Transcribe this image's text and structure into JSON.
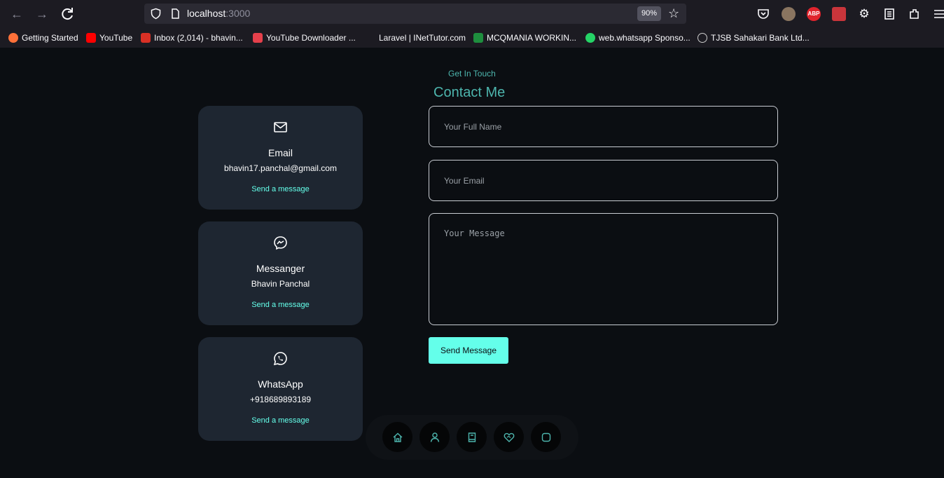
{
  "browser": {
    "url_host": "localhost",
    "url_port": ":3000",
    "zoom": "90%",
    "bookmarks": [
      {
        "label": "Getting Started",
        "color": "#ff7139"
      },
      {
        "label": "YouTube",
        "color": "#ff0000"
      },
      {
        "label": "Inbox (2,014) - bhavin...",
        "color": "#d93025"
      },
      {
        "label": "YouTube Downloader ...",
        "color": "#e5404b"
      },
      {
        "label": "Laravel | INetTutor.com",
        "color": ""
      },
      {
        "label": "MCQMANIA WORKIN...",
        "color": "#1e8e3e"
      },
      {
        "label": "web.whatsapp Sponso...",
        "color": "#25d366"
      },
      {
        "label": "TJSB Sahakari Bank Ltd...",
        "color": "#cccccc"
      }
    ]
  },
  "section": {
    "subtitle": "Get In Touch",
    "title": "Contact Me"
  },
  "contacts": [
    {
      "icon": "mail-icon",
      "title": "Email",
      "value": "bhavin17.panchal@gmail.com",
      "link": "Send a message"
    },
    {
      "icon": "messenger-icon",
      "title": "Messanger",
      "value": "Bhavin Panchal",
      "link": "Send a message"
    },
    {
      "icon": "whatsapp-icon",
      "title": "WhatsApp",
      "value": "+918689893189",
      "link": "Send a message"
    }
  ],
  "form": {
    "name_placeholder": "Your Full Name",
    "email_placeholder": "Your Email",
    "message_placeholder": "Your Message",
    "submit_label": "Send Message"
  },
  "nav": [
    "home-icon",
    "user-icon",
    "book-icon",
    "services-icon",
    "message-icon"
  ],
  "colors": {
    "accent": "#64ffea",
    "heading": "#4db5ad",
    "card": "#1e2631",
    "background": "#0b0e12"
  }
}
